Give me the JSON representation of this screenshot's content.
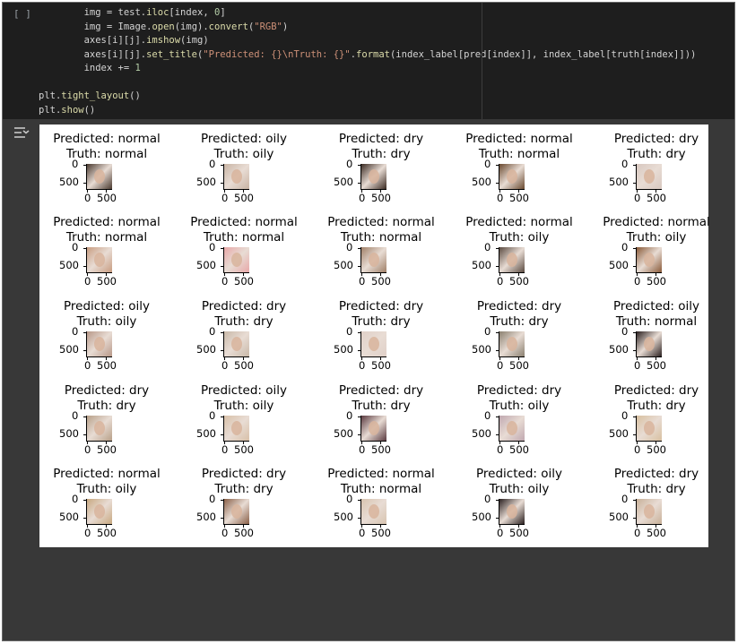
{
  "cell": {
    "run_label": "[ ]",
    "code_lines": [
      "        img = test.iloc[index, 0]",
      "        img = Image.open(img).convert(\"RGB\")",
      "        axes[i][j].imshow(img)",
      "        axes[i][j].set_title(\"Predicted: {}\\nTruth: {}\".format(index_label[pred[index]], index_label[truth[index]]))",
      "        index += 1",
      "",
      "plt.tight_layout()",
      "plt.show()"
    ]
  },
  "output": {
    "icon": "output-toggle-icon",
    "ticks": {
      "y_top": "0",
      "y_bottom": "500",
      "x_left": "0",
      "x_right": "500"
    },
    "grid": [
      [
        {
          "predicted": "Predicted: normal",
          "truth": "Truth: normal",
          "tone": "#4a3a30"
        },
        {
          "predicted": "Predicted: oily",
          "truth": "Truth: oily",
          "tone": "#c8b4a4"
        },
        {
          "predicted": "Predicted: dry",
          "truth": "Truth: dry",
          "tone": "#3a2a22"
        },
        {
          "predicted": "Predicted: normal",
          "truth": "Truth: normal",
          "tone": "#6a4a30"
        },
        {
          "predicted": "Predicted: dry",
          "truth": "Truth: dry",
          "tone": "#d8c8c0"
        }
      ],
      [
        {
          "predicted": "Predicted: normal",
          "truth": "Truth: normal",
          "tone": "#c89c80"
        },
        {
          "predicted": "Predicted: normal",
          "truth": "Truth: normal",
          "tone": "#e8a8a8"
        },
        {
          "predicted": "Predicted: normal",
          "truth": "Truth: normal",
          "tone": "#a08068"
        },
        {
          "predicted": "Predicted: normal",
          "truth": "Truth: oily",
          "tone": "#5a4a40"
        },
        {
          "predicted": "Predicted: normal",
          "truth": "Truth: oily",
          "tone": "#8a5a38"
        }
      ],
      [
        {
          "predicted": "Predicted: oily",
          "truth": "Truth: oily",
          "tone": "#b89888"
        },
        {
          "predicted": "Predicted: dry",
          "truth": "Truth: dry",
          "tone": "#c8b8a8"
        },
        {
          "predicted": "Predicted: dry",
          "truth": "Truth: dry",
          "tone": "#e0d0c8"
        },
        {
          "predicted": "Predicted: dry",
          "truth": "Truth: dry",
          "tone": "#8a8070"
        },
        {
          "predicted": "Predicted: oily",
          "truth": "Truth: normal",
          "tone": "#2a2020"
        }
      ],
      [
        {
          "predicted": "Predicted: dry",
          "truth": "Truth: dry",
          "tone": "#b8a088"
        },
        {
          "predicted": "Predicted: oily",
          "truth": "Truth: oily",
          "tone": "#d8c0a8"
        },
        {
          "predicted": "Predicted: dry",
          "truth": "Truth: dry",
          "tone": "#5a3a40"
        },
        {
          "predicted": "Predicted: dry",
          "truth": "Truth: oily",
          "tone": "#c0a8b0"
        },
        {
          "predicted": "Predicted: dry",
          "truth": "Truth: dry",
          "tone": "#d8c0a0"
        }
      ],
      [
        {
          "predicted": "Predicted: normal",
          "truth": "Truth: oily",
          "tone": "#c8a880"
        },
        {
          "predicted": "Predicted: dry",
          "truth": "Truth: dry",
          "tone": "#8a6048"
        },
        {
          "predicted": "Predicted: normal",
          "truth": "Truth: normal",
          "tone": "#d8c4b0"
        },
        {
          "predicted": "Predicted: oily",
          "truth": "Truth: oily",
          "tone": "#2a2020"
        },
        {
          "predicted": "Predicted: dry",
          "truth": "Truth: dry",
          "tone": "#c8b098"
        }
      ]
    ]
  }
}
